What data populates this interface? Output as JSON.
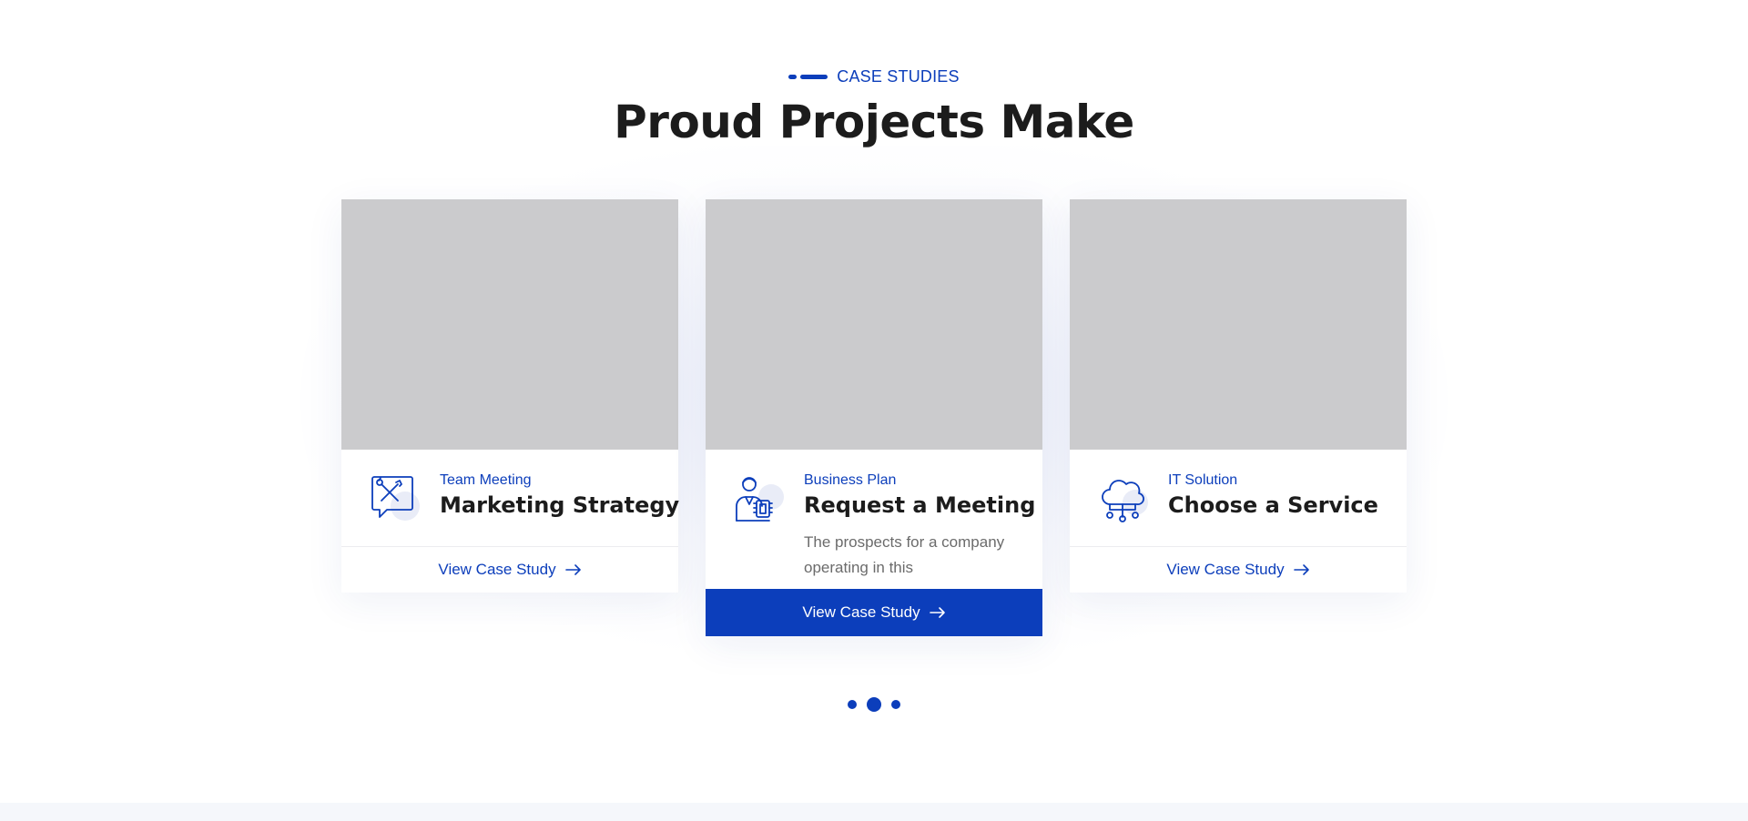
{
  "section": {
    "eyebrow": "CASE STUDIES",
    "title": "Proud Projects Make"
  },
  "accent_color": "#0c3ebb",
  "cards": [
    {
      "tag": "Team Meeting",
      "title": "Marketing Strategy",
      "description": "",
      "link_label": "View Case Study",
      "icon": "tools-chat-icon",
      "active": false
    },
    {
      "tag": "Business Plan",
      "title": "Request a Meeting",
      "description": "The prospects for a company operating in this",
      "link_label": "View Case Study",
      "icon": "engineer-chip-icon",
      "active": true
    },
    {
      "tag": "IT Solution",
      "title": "Choose a Service",
      "description": "",
      "link_label": "View Case Study",
      "icon": "cloud-network-icon",
      "active": false
    }
  ],
  "pagination": {
    "total": 3,
    "active_index": 1
  }
}
